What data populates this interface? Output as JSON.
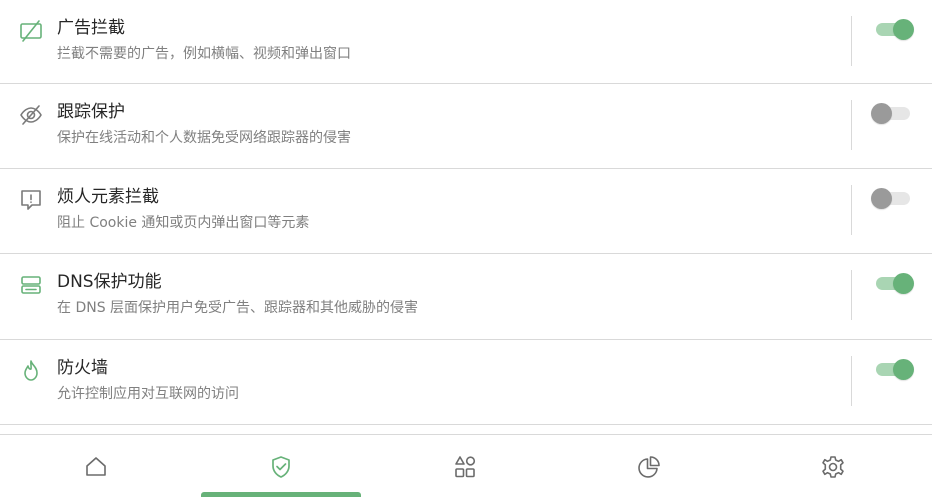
{
  "accent_color": "#67b279",
  "settings": [
    {
      "icon": "ad-block-icon",
      "title": "广告拦截",
      "description": "拦截不需要的广告，例如横幅、视频和弹出窗口",
      "enabled": true
    },
    {
      "icon": "eye-off-icon",
      "title": "跟踪保护",
      "description": "保护在线活动和个人数据免受网络跟踪器的侵害",
      "enabled": false
    },
    {
      "icon": "message-alert-icon",
      "title": "烦人元素拦截",
      "description": "阻止 Cookie 通知或页内弹出窗口等元素",
      "enabled": false
    },
    {
      "icon": "server-icon",
      "title": "DNS保护功能",
      "description": "在 DNS 层面保护用户免受广告、跟踪器和其他威胁的侵害",
      "enabled": true
    },
    {
      "icon": "flame-icon",
      "title": "防火墙",
      "description": "允许控制应用对互联网的访问",
      "enabled": true
    }
  ],
  "bottom_nav": {
    "items": [
      "home-icon",
      "shield-check-icon",
      "apps-grid-icon",
      "pie-chart-icon",
      "gear-icon"
    ],
    "active": "shield-check-icon"
  }
}
